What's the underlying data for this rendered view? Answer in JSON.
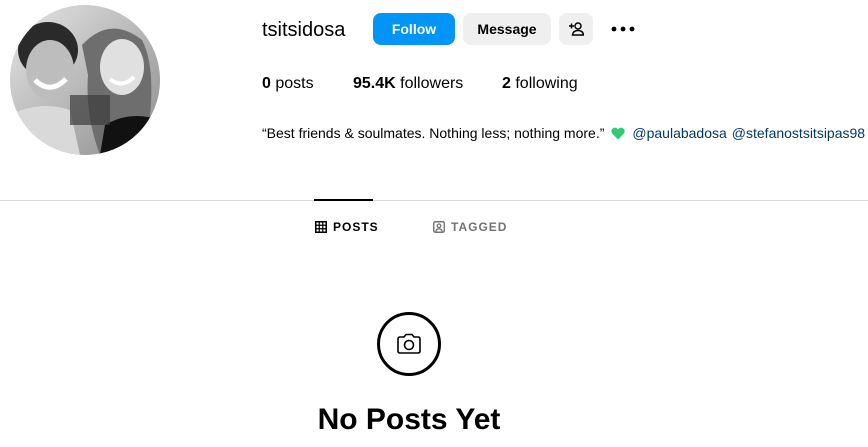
{
  "profile": {
    "username": "tsitsidosa",
    "follow_label": "Follow",
    "message_label": "Message",
    "add_user_icon": "person-add-icon",
    "more_icon": "more-horizontal-icon"
  },
  "stats": {
    "posts_count": "0",
    "posts_label": "posts",
    "followers_count": "95.4K",
    "followers_label": "followers",
    "following_count": "2",
    "following_label": "following"
  },
  "bio": {
    "text": "“Best friends & soulmates. Nothing less; nothing more.”",
    "heart_color": "#2ecc71",
    "mentions": [
      "@paulabadosa",
      "@stefanostsitsipas98"
    ]
  },
  "tabs": [
    {
      "label": "POSTS",
      "icon": "grid-icon",
      "active": true
    },
    {
      "label": "TAGGED",
      "icon": "tagged-user-icon",
      "active": false
    }
  ],
  "empty_state": {
    "icon": "camera-icon",
    "title": "No Posts Yet"
  },
  "colors": {
    "follow_button": "#0095f6",
    "secondary_button": "#efefef",
    "mention_link": "#00376b",
    "inactive_tab": "#737373"
  }
}
